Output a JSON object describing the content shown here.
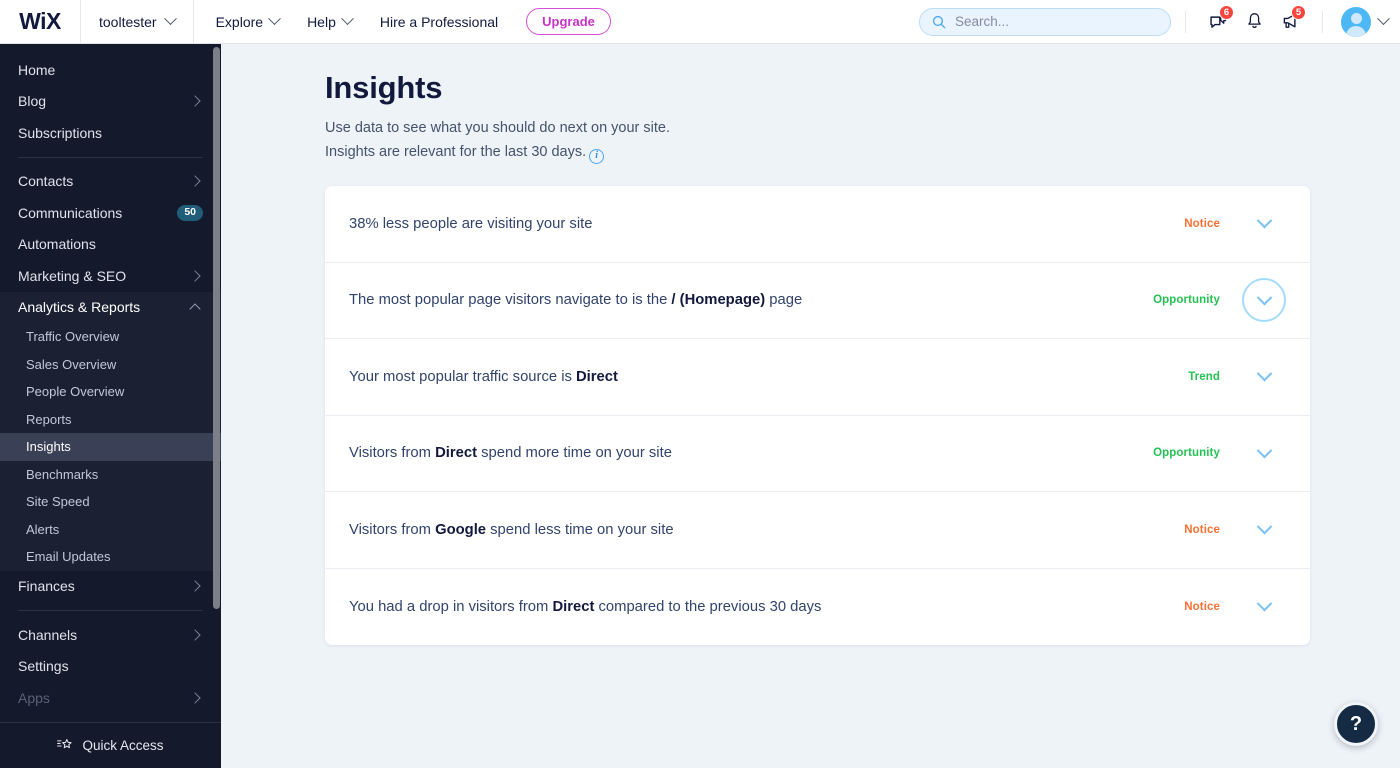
{
  "topbar": {
    "logo": "WiX",
    "site_name": "tooltester",
    "menu": [
      {
        "label": "Explore",
        "has_caret": true
      },
      {
        "label": "Help",
        "has_caret": true
      },
      {
        "label": "Hire a Professional",
        "has_caret": false
      }
    ],
    "upgrade_label": "Upgrade",
    "search_placeholder": "Search...",
    "search_value": "",
    "icons": [
      {
        "name": "chat-icon",
        "badge": "6"
      },
      {
        "name": "bell-icon",
        "badge": ""
      },
      {
        "name": "megaphone-icon",
        "badge": "5"
      }
    ],
    "badge_color": "#f9453e",
    "upgrade_color": "#c832c8"
  },
  "sidebar": {
    "items": [
      {
        "label": "Home",
        "arrow": false
      },
      {
        "label": "Blog",
        "arrow": true
      },
      {
        "label": "Subscriptions",
        "arrow": false
      },
      {
        "divider": true
      },
      {
        "label": "Contacts",
        "arrow": true
      },
      {
        "label": "Communications",
        "arrow": false,
        "pill": "50"
      },
      {
        "label": "Automations",
        "arrow": false
      },
      {
        "label": "Marketing & SEO",
        "arrow": true
      }
    ],
    "group": {
      "label": "Analytics & Reports",
      "expanded": true,
      "sub_items": [
        {
          "label": "Traffic Overview",
          "active": false
        },
        {
          "label": "Sales Overview",
          "active": false
        },
        {
          "label": "People Overview",
          "active": false
        },
        {
          "label": "Reports",
          "active": false
        },
        {
          "label": "Insights",
          "active": true
        },
        {
          "label": "Benchmarks",
          "active": false
        },
        {
          "label": "Site Speed",
          "active": false
        },
        {
          "label": "Alerts",
          "active": false
        },
        {
          "label": "Email Updates",
          "active": false
        }
      ]
    },
    "items_after": [
      {
        "label": "Finances",
        "arrow": true
      },
      {
        "divider": true
      },
      {
        "label": "Channels",
        "arrow": true
      },
      {
        "label": "Settings",
        "arrow": false
      },
      {
        "label": "Apps",
        "arrow": true,
        "dim": true
      }
    ],
    "footer_label": "Quick Access",
    "pill_color": "#1f5d79",
    "active_bg": "#3a4055"
  },
  "main": {
    "title": "Insights",
    "subtitle_line1": "Use data to see what you should do next on your site.",
    "subtitle_line2": "Insights are relevant for the last 30 days.",
    "info_icon_char": "i",
    "insights": [
      {
        "text_before": "38% less people are visiting your site",
        "bold": "",
        "text_after": "",
        "tag": "Notice",
        "tag_type": "notice",
        "focused": false
      },
      {
        "text_before": "The most popular page visitors navigate to is the ",
        "bold": "/ (Homepage)",
        "text_after": " page",
        "tag": "Opportunity",
        "tag_type": "opportunity",
        "focused": true
      },
      {
        "text_before": "Your most popular traffic source is ",
        "bold": "Direct",
        "text_after": "",
        "tag": "Trend",
        "tag_type": "trend",
        "focused": false
      },
      {
        "text_before": "Visitors from ",
        "bold": "Direct",
        "text_after": " spend more time on your site",
        "tag": "Opportunity",
        "tag_type": "opportunity",
        "focused": false
      },
      {
        "text_before": "Visitors from ",
        "bold": "Google",
        "text_after": " spend less time on your site",
        "tag": "Notice",
        "tag_type": "notice",
        "focused": false
      },
      {
        "text_before": "You had a drop in visitors from ",
        "bold": "Direct",
        "text_after": " compared to the previous 30 days",
        "tag": "Notice",
        "tag_type": "notice",
        "focused": false
      }
    ],
    "help_fab_char": "?",
    "colors": {
      "notice": "#fb7034",
      "opportunity": "#26c154",
      "trend": "#26c154",
      "chevron": "#7bc2f2",
      "page_bg": "#eef3f7"
    }
  }
}
